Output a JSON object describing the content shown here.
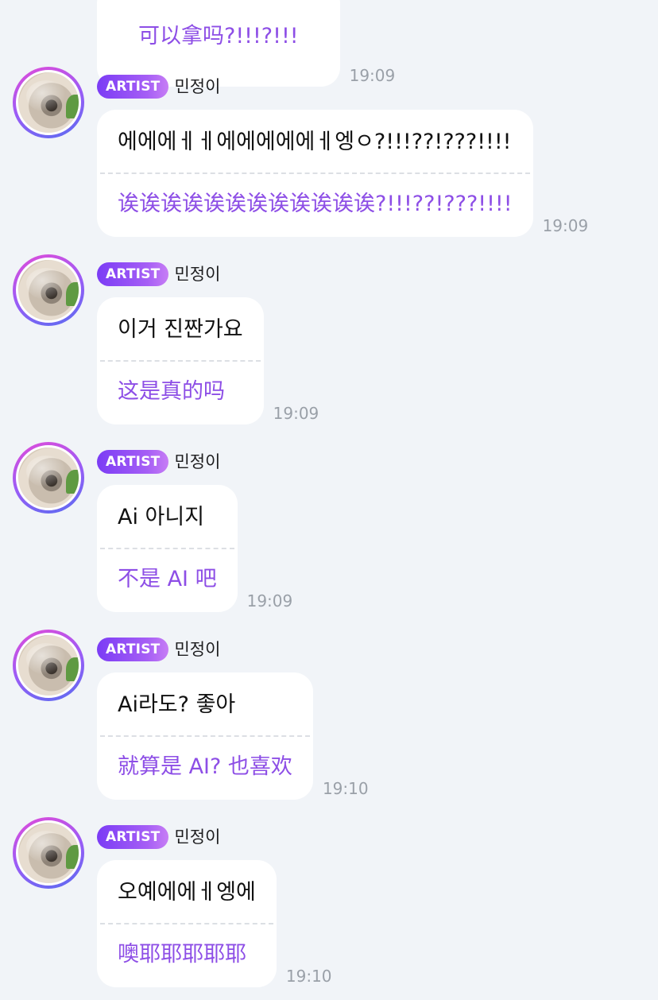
{
  "top_message": {
    "translation": "可以拿吗?!!!?!!!",
    "time": "19:09"
  },
  "messages": [
    {
      "badge": "ARTIST",
      "sender": "민정이",
      "original": "에에에ㅔㅔ에에에에에ㅔ엥ㅇ?!!!??!???!!!!",
      "translation": "诶诶诶诶诶诶诶诶诶诶诶诶?!!!??!???!!!!",
      "time": "19:09"
    },
    {
      "badge": "ARTIST",
      "sender": "민정이",
      "original": "이거 진짠가요",
      "translation": "这是真的吗",
      "time": "19:09"
    },
    {
      "badge": "ARTIST",
      "sender": "민정이",
      "original": "Ai 아니지",
      "translation": "不是 AI 吧",
      "time": "19:09"
    },
    {
      "badge": "ARTIST",
      "sender": "민정이",
      "original": "Ai라도? 좋아",
      "translation": "就算是 AI?  也喜欢",
      "time": "19:10"
    },
    {
      "badge": "ARTIST",
      "sender": "민정이",
      "original": "오예에에ㅔ엥에",
      "translation": "噢耶耶耶耶耶",
      "time": "19:10"
    }
  ]
}
